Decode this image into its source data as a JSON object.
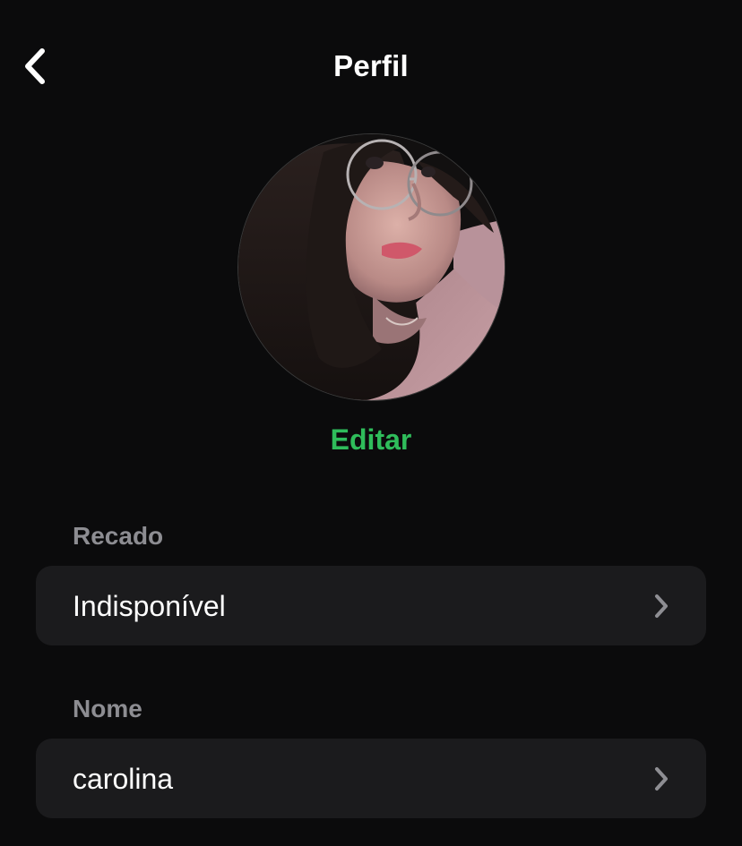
{
  "header": {
    "title": "Perfil",
    "back_icon": "chevron-left-icon"
  },
  "profile": {
    "edit_label": "Editar",
    "accent_color": "#2fbd5b"
  },
  "fields": [
    {
      "label": "Recado",
      "value": "Indisponível",
      "icon": "chevron-right-icon"
    },
    {
      "label": "Nome",
      "value": "carolina",
      "icon": "chevron-right-icon"
    }
  ],
  "colors": {
    "background": "#0b0b0c",
    "row_background": "#1b1b1d",
    "section_label": "#8d8d92",
    "chevron": "#8e8e93"
  }
}
